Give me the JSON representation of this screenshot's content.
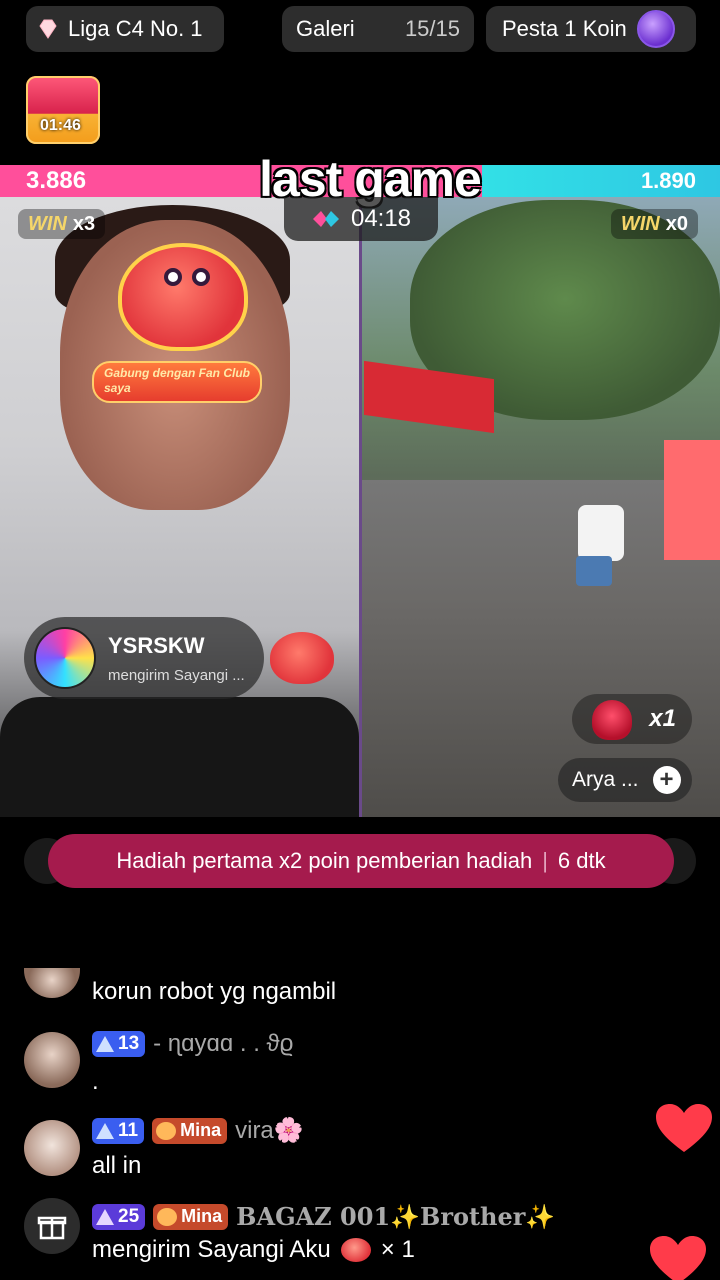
{
  "top_bar": {
    "league_label": "Liga C4 No. 1",
    "gallery_label": "Galeri",
    "gallery_count": "15/15",
    "party_label": "Pesta 1 Koin"
  },
  "treasure": {
    "timer": "01:46"
  },
  "battle": {
    "overlay_title": "last game",
    "score_left": "3.886",
    "score_right": "1.890",
    "score_left_share": 0.67,
    "timer": "04:18",
    "left": {
      "win_word": "WIN",
      "win_count": "x3"
    },
    "right": {
      "win_word": "WIN",
      "win_count": "x0"
    },
    "fanclub_label": "Gabung dengan Fan Club saya",
    "gift_notice": {
      "user": "YSRSKW",
      "action": "mengirim Sayangi ..."
    },
    "rose_count": "x1",
    "follow_name": "Arya ...",
    "follow_plus": "+"
  },
  "banner": {
    "text": "Hadiah pertama x2 poin pemberian hadiah",
    "countdown": "6 dtk"
  },
  "chat": [
    {
      "text": "korun robot yg ngambil"
    },
    {
      "level": "13",
      "name": "- ɳɑуɑɑ . . ϑϱ",
      "text": "."
    },
    {
      "level": "11",
      "fan": "Mina",
      "name": "vira🌸",
      "text": "all in"
    },
    {
      "level": "25",
      "fan": "Mina",
      "name": "BAGAZ 001✨Brother✨",
      "text": "mengirim Sayangi Aku",
      "gift_count": "× 1"
    }
  ],
  "colors": {
    "score_left": "#ff4f9b",
    "score_right": "#2ec7e3",
    "banner": "#a51b4d",
    "like_heart": "#ff3b4a"
  },
  "icons": [
    "diamond-icon",
    "party-coin-icon",
    "treasure-box-icon",
    "battle-icon",
    "rose-icon",
    "gift-icon",
    "heart-icon"
  ]
}
